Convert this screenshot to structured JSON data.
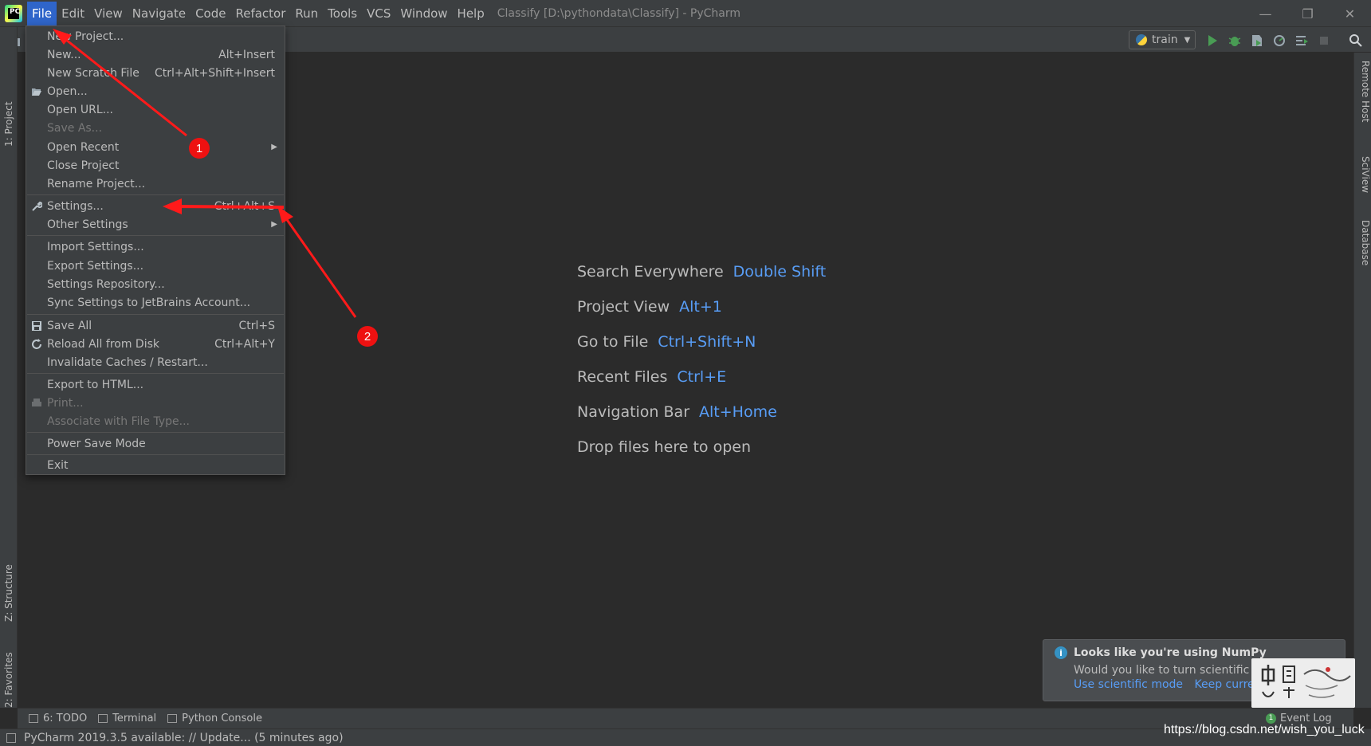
{
  "app": {
    "window_title": "Classify [D:\\pythondata\\Classify] - PyCharm",
    "logo_text": "PC"
  },
  "menubar": {
    "items": [
      "File",
      "Edit",
      "View",
      "Navigate",
      "Code",
      "Refactor",
      "Run",
      "Tools",
      "VCS",
      "Window",
      "Help"
    ],
    "active": "File"
  },
  "toolbar": {
    "run_config": "train"
  },
  "left_tabs": {
    "project": "1: Project",
    "structure": "Z: Structure",
    "favorites": "2: Favorites"
  },
  "right_tabs": {
    "remote_host": "Remote Host",
    "sciview": "SciView",
    "database": "Database"
  },
  "file_menu": {
    "items": [
      {
        "label": "New Project...",
        "shortcut": ""
      },
      {
        "label": "New...",
        "shortcut": "Alt+Insert"
      },
      {
        "label": "New Scratch File",
        "shortcut": "Ctrl+Alt+Shift+Insert"
      },
      {
        "label": "Open...",
        "shortcut": ""
      },
      {
        "label": "Open URL...",
        "shortcut": ""
      },
      {
        "label": "Save As...",
        "shortcut": "",
        "disabled": true
      },
      {
        "label": "Open Recent",
        "shortcut": "",
        "submenu": true
      },
      {
        "label": "Close Project",
        "shortcut": ""
      },
      {
        "label": "Rename Project...",
        "shortcut": ""
      },
      {
        "label": "Settings...",
        "shortcut": "Ctrl+Alt+S"
      },
      {
        "label": "Other Settings",
        "shortcut": "",
        "submenu": true
      },
      {
        "label": "Import Settings...",
        "shortcut": ""
      },
      {
        "label": "Export Settings...",
        "shortcut": ""
      },
      {
        "label": "Settings Repository...",
        "shortcut": ""
      },
      {
        "label": "Sync Settings to JetBrains Account...",
        "shortcut": ""
      },
      {
        "label": "Save All",
        "shortcut": "Ctrl+S"
      },
      {
        "label": "Reload All from Disk",
        "shortcut": "Ctrl+Alt+Y"
      },
      {
        "label": "Invalidate Caches / Restart...",
        "shortcut": ""
      },
      {
        "label": "Export to HTML...",
        "shortcut": ""
      },
      {
        "label": "Print...",
        "shortcut": "",
        "disabled": true
      },
      {
        "label": "Associate with File Type...",
        "shortcut": "",
        "disabled": true
      },
      {
        "label": "Power Save Mode",
        "shortcut": ""
      },
      {
        "label": "Exit",
        "shortcut": ""
      }
    ]
  },
  "welcome_hints": [
    {
      "label": "Search Everywhere",
      "key": "Double Shift"
    },
    {
      "label": "Project View",
      "key": "Alt+1"
    },
    {
      "label": "Go to File",
      "key": "Ctrl+Shift+N"
    },
    {
      "label": "Recent Files",
      "key": "Ctrl+E"
    },
    {
      "label": "Navigation Bar",
      "key": "Alt+Home"
    },
    {
      "label": "Drop files here to open",
      "key": ""
    }
  ],
  "bottom_tabs": {
    "todo": "6: TODO",
    "terminal": "Terminal",
    "python_console": "Python Console",
    "event_log": "Event Log",
    "event_count": "1"
  },
  "notification": {
    "title": "Looks like you're using NumPy",
    "body": "Would you like to turn scientific mode on?",
    "link1": "Use scientific mode",
    "link2": "Keep current layout..."
  },
  "status": {
    "text": "PyCharm 2019.3.5 available: // Update... (5 minutes ago)"
  },
  "watermark": "https://blog.csdn.net/wish_you_luck",
  "annotations": {
    "badge1": "1",
    "badge2": "2",
    "color": "#ff1a1a"
  }
}
